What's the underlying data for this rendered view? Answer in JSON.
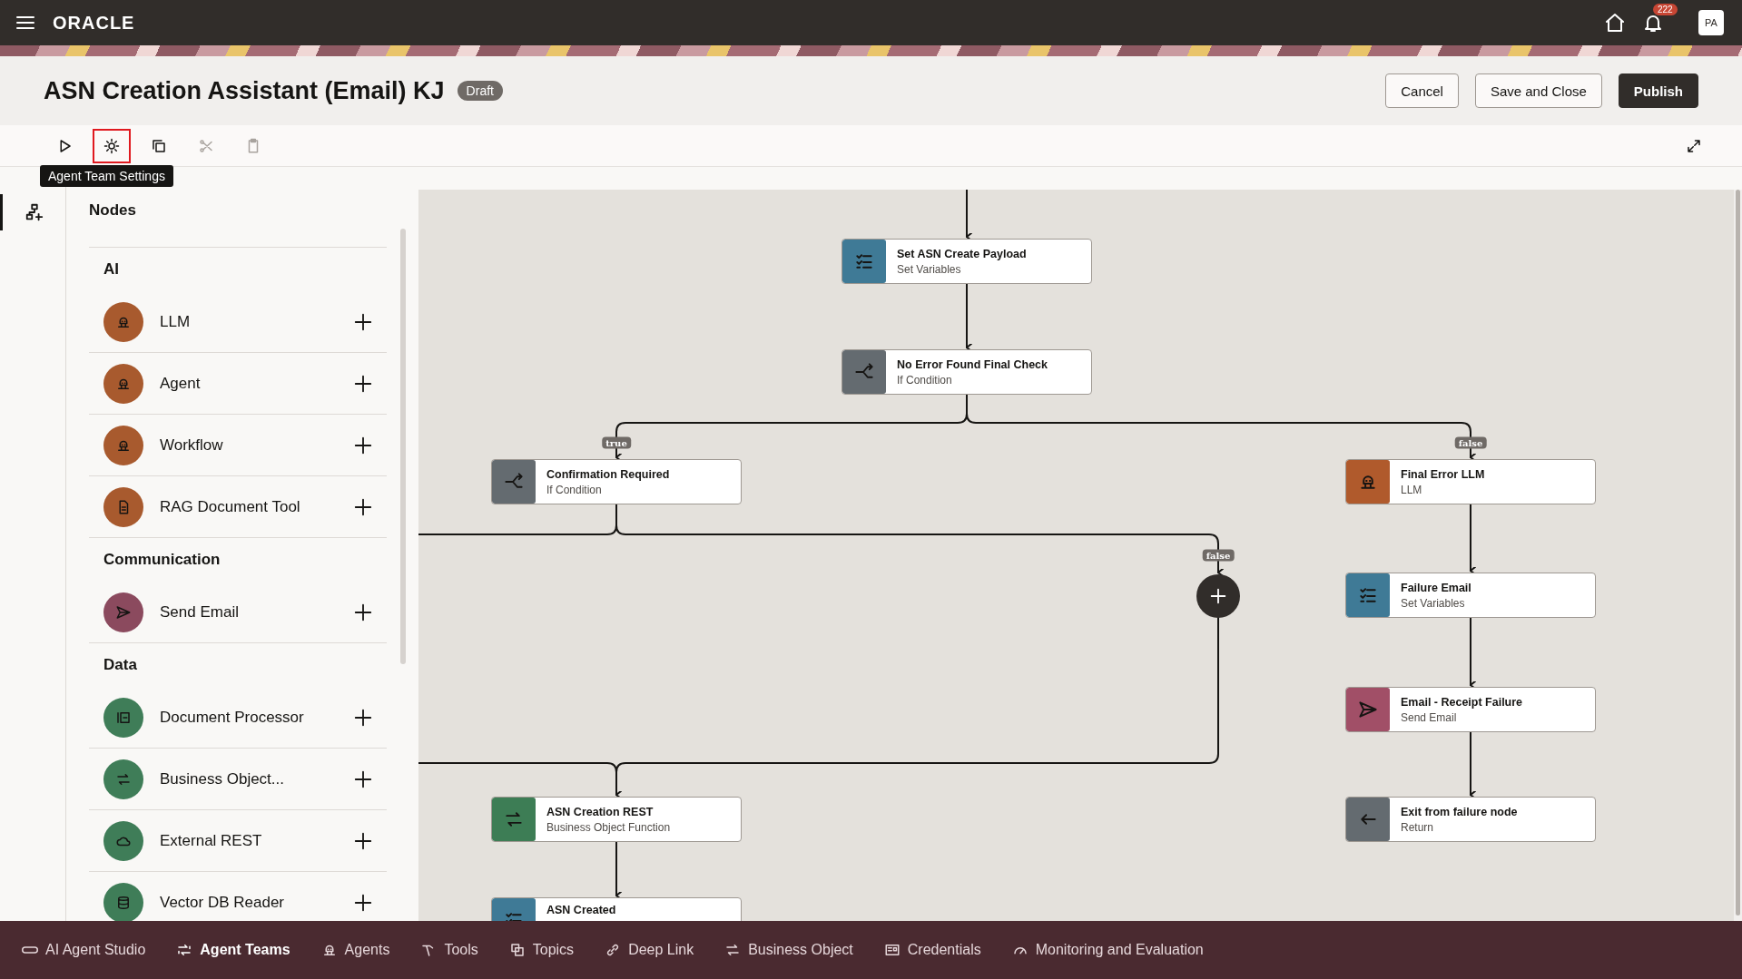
{
  "top_bar": {
    "logo": "ORACLE",
    "notification_count": "222",
    "avatar": "PA"
  },
  "header": {
    "title": "ASN Creation Assistant (Email) KJ",
    "status": "Draft",
    "buttons": [
      {
        "label": "Cancel",
        "kind": "secondary"
      },
      {
        "label": "Save and Close",
        "kind": "secondary"
      },
      {
        "label": "Publish",
        "kind": "primary"
      }
    ]
  },
  "toolbar": {
    "tools": [
      {
        "kind": "play",
        "highlighted": false,
        "disabled": false
      },
      {
        "kind": "gear",
        "highlighted": true,
        "disabled": false
      },
      {
        "kind": "copy",
        "highlighted": false,
        "disabled": false
      },
      {
        "kind": "scissors",
        "highlighted": false,
        "disabled": true
      },
      {
        "kind": "paste",
        "highlighted": false,
        "disabled": true
      }
    ],
    "tooltip": "Agent Team Settings"
  },
  "nodes_panel": {
    "title": "Nodes",
    "sections": [
      {
        "title": "AI",
        "kind": "ai",
        "items": [
          {
            "label": "LLM",
            "kind": "robot"
          },
          {
            "label": "Agent",
            "kind": "robot"
          },
          {
            "label": "Workflow",
            "kind": "robot"
          },
          {
            "label": "RAG Document Tool",
            "kind": "document"
          }
        ]
      },
      {
        "title": "Communication",
        "kind": "communication",
        "items": [
          {
            "label": "Send Email",
            "kind": "send"
          }
        ]
      },
      {
        "title": "Data",
        "kind": "data",
        "items": [
          {
            "label": "Document Processor",
            "kind": "processor"
          },
          {
            "label": "Business Object...",
            "kind": "exchange"
          },
          {
            "label": "External REST",
            "kind": "cloud"
          },
          {
            "label": "Vector DB Reader",
            "kind": "database"
          }
        ]
      }
    ]
  },
  "canvas": {
    "nodes": [
      {
        "title": "Set ASN Create Payload",
        "subtitle": "Set Variables",
        "kind": "set-variables"
      },
      {
        "title": "No Error Found Final Check",
        "subtitle": "If Condition",
        "kind": "if-condition"
      },
      {
        "title": "Confirmation Required",
        "subtitle": "If Condition",
        "kind": "if-condition"
      },
      {
        "title": "Final Error LLM",
        "subtitle": "LLM",
        "kind": "llm"
      },
      {
        "title": "Failure Email",
        "subtitle": "Set Variables",
        "kind": "set-variables"
      },
      {
        "title": "Email - Receipt Failure",
        "subtitle": "Send Email",
        "kind": "send-email"
      },
      {
        "title": "ASN Creation REST",
        "subtitle": "Business Object Function",
        "kind": "business-object"
      },
      {
        "title": "Exit from failure node",
        "subtitle": "Return",
        "kind": "return"
      },
      {
        "title": "ASN Created",
        "kind": "set-variables"
      }
    ],
    "branch_labels": [
      "true",
      "false",
      "false"
    ]
  },
  "bottom_nav": [
    {
      "label": "AI Agent Studio",
      "kind": "studio",
      "selected": false
    },
    {
      "label": "Agent Teams",
      "kind": "teams",
      "selected": true
    },
    {
      "label": "Agents",
      "kind": "robot",
      "selected": false
    },
    {
      "label": "Tools",
      "kind": "tools",
      "selected": false
    },
    {
      "label": "Topics",
      "kind": "topics",
      "selected": false
    },
    {
      "label": "Deep Link",
      "kind": "link",
      "selected": false
    },
    {
      "label": "Business Object",
      "kind": "exchange",
      "selected": false
    },
    {
      "label": "Credentials",
      "kind": "card",
      "selected": false
    },
    {
      "label": "Monitoring and Evaluation",
      "kind": "gauge",
      "selected": false
    }
  ]
}
